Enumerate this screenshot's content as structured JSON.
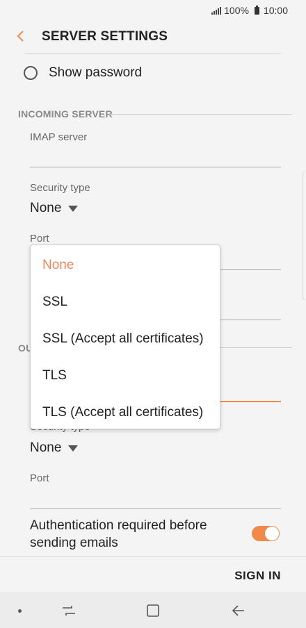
{
  "status_bar": {
    "battery_percent": "100%",
    "time": "10:00"
  },
  "header": {
    "title": "SERVER SETTINGS"
  },
  "show_password": {
    "label": "Show password",
    "checked": false
  },
  "incoming": {
    "section_title": "INCOMING SERVER",
    "imap_label": "IMAP server",
    "imap_value": "",
    "security_label": "Security type",
    "security_value": "None",
    "port_label": "Port"
  },
  "outgoing": {
    "section_title_visible": "OU",
    "security_label": "Security type",
    "security_value": "None",
    "port_label": "Port"
  },
  "dropdown": {
    "options": [
      "None",
      "SSL",
      "SSL (Accept all certificates)",
      "TLS",
      "TLS (Accept all certificates)"
    ],
    "selected": "None"
  },
  "auth": {
    "label": "Authentication required before sending emails",
    "enabled": true
  },
  "footer": {
    "sign_in_label": "SIGN IN"
  },
  "colors": {
    "accent": "#f08a4b",
    "background": "#f4f4f4"
  },
  "icons": {
    "back": "back-chevron-icon",
    "signal": "signal-icon",
    "battery": "battery-icon",
    "nav_recent": "recent-apps-icon",
    "nav_home": "home-icon",
    "nav_back": "back-arrow-icon"
  }
}
